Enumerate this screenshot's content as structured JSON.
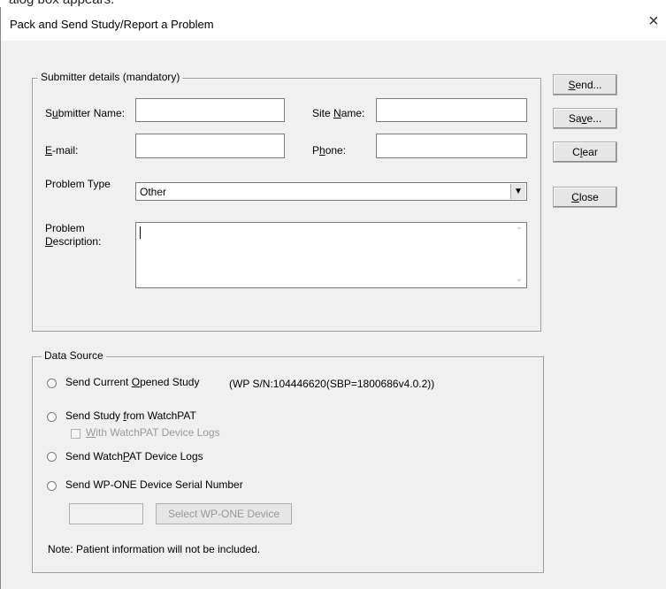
{
  "dialog": {
    "title": "Pack and Send Study/Report a Problem",
    "close_glyph": "×",
    "top_partial_text": "alog box appears."
  },
  "submitter": {
    "legend": "Submitter details (mandatory)",
    "name_label_pre": "S",
    "name_label_u": "u",
    "name_label_post": "bmitter Name:",
    "name_value": "",
    "site_label_pre": "Site ",
    "site_label_u": "N",
    "site_label_post": "ame:",
    "site_value": "",
    "email_label_u": "E",
    "email_label_post": "-mail:",
    "email_value": "",
    "phone_label_pre": "P",
    "phone_label_u": "h",
    "phone_label_post": "one:",
    "phone_value": "",
    "problem_type_label": "Problem Type",
    "problem_type_value": "Other",
    "problem_desc_label_1": "Problem",
    "problem_desc_label_2_u": "D",
    "problem_desc_label_2_post": "escription:",
    "problem_desc_value": ""
  },
  "buttons": {
    "send_u": "S",
    "send_post": "end...",
    "save_pre": "Sa",
    "save_u": "v",
    "save_post": "e...",
    "clear_pre": "C",
    "clear_u": "l",
    "clear_post": "ear",
    "close_u": "C",
    "close_post": "lose"
  },
  "data_source": {
    "legend": "Data Source",
    "opt1_pre": "Send Current ",
    "opt1_u": "O",
    "opt1_post": "pened Study",
    "opt1_info": "(WP S/N:104446620(SBP=1800686v4.0.2))",
    "opt2_pre": "Send Study ",
    "opt2_u": "f",
    "opt2_post": "rom WatchPAT",
    "opt2_sub_u": "W",
    "opt2_sub_post": "ith WatchPAT Device Logs",
    "opt3_pre": "Send Watch",
    "opt3_u": "P",
    "opt3_post": "AT Device Logs",
    "opt4": "Send WP-ONE Device Serial Number",
    "serial_value": "",
    "select_device_label": "Select WP-ONE Device",
    "note": "Note: Patient information will not be included."
  }
}
